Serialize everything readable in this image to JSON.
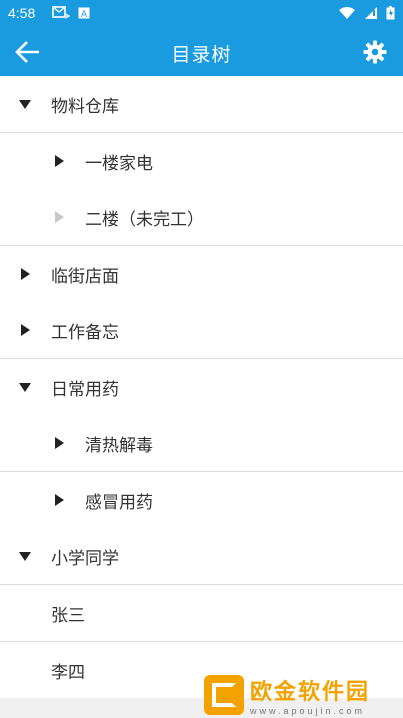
{
  "status_bar": {
    "time": "4:58"
  },
  "toolbar": {
    "title": "目录树"
  },
  "tree": {
    "items": [
      {
        "label": "物料仓库",
        "expanded": true
      },
      {
        "label": "一楼家电"
      },
      {
        "label": "二楼（未完工）"
      },
      {
        "label": "临街店面"
      },
      {
        "label": "工作备忘"
      },
      {
        "label": "日常用药",
        "expanded": true
      },
      {
        "label": "清热解毒"
      },
      {
        "label": "感冒用药"
      },
      {
        "label": "小学同学",
        "expanded": true
      },
      {
        "label": "张三"
      },
      {
        "label": "李四"
      }
    ]
  },
  "watermark": {
    "title": "欧金软件园",
    "subtitle": "www.apoujin.com"
  },
  "colors": {
    "accent": "#1a9be0",
    "watermark": "#f3a200"
  },
  "icons": {
    "back": "arrow-left-icon",
    "settings": "gear-icon",
    "expanded": "triangle-down-icon",
    "collapsed": "triangle-right-icon"
  }
}
